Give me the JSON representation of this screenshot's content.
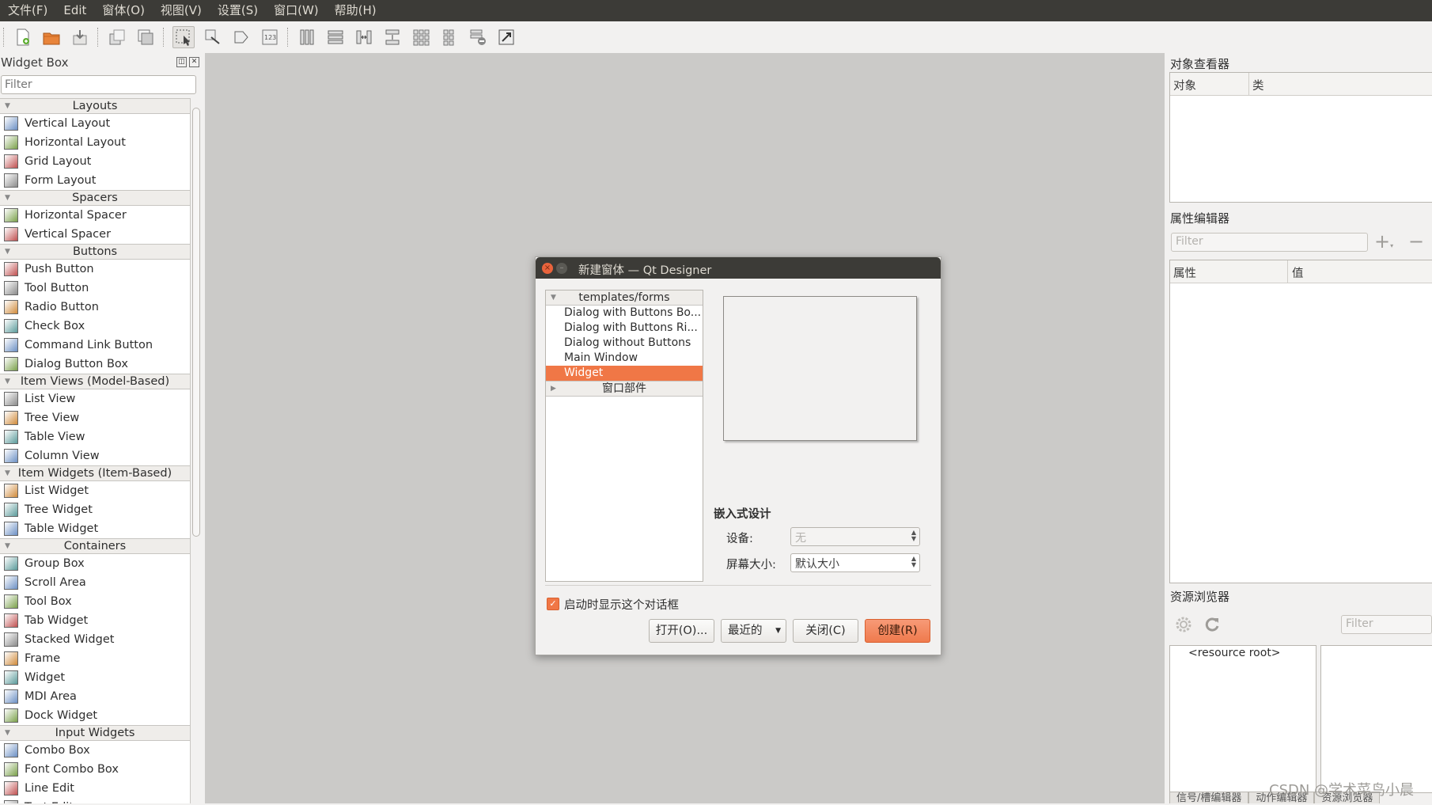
{
  "menu": [
    "文件(F)",
    "Edit",
    "窗体(O)",
    "视图(V)",
    "设置(S)",
    "窗口(W)",
    "帮助(H)"
  ],
  "toolbar": {
    "icons": [
      "new-form-icon",
      "open-form-icon",
      "save-form-icon",
      "cut-icon",
      "copy-icon",
      "edit-widgets-icon",
      "edit-signals-icon",
      "edit-buddies-icon",
      "edit-tab-order-icon",
      "lay-out-horizontally-icon",
      "lay-out-vertically-icon",
      "horizontal-splitter-icon",
      "vertical-splitter-icon",
      "grid-layout-icon",
      "form-layout-icon",
      "break-layout-icon",
      "adjust-size-icon"
    ]
  },
  "widget_box": {
    "title": "Widget Box",
    "filter_placeholder": "Filter",
    "categories": [
      {
        "name": "Layouts",
        "items": [
          "Vertical Layout",
          "Horizontal Layout",
          "Grid Layout",
          "Form Layout"
        ]
      },
      {
        "name": "Spacers",
        "items": [
          "Horizontal Spacer",
          "Vertical Spacer"
        ]
      },
      {
        "name": "Buttons",
        "items": [
          "Push Button",
          "Tool Button",
          "Radio Button",
          "Check Box",
          "Command Link Button",
          "Dialog Button Box"
        ]
      },
      {
        "name": "Item Views (Model-Based)",
        "items": [
          "List View",
          "Tree View",
          "Table View",
          "Column View"
        ]
      },
      {
        "name": "Item Widgets (Item-Based)",
        "items": [
          "List Widget",
          "Tree Widget",
          "Table Widget"
        ]
      },
      {
        "name": "Containers",
        "items": [
          "Group Box",
          "Scroll Area",
          "Tool Box",
          "Tab Widget",
          "Stacked Widget",
          "Frame",
          "Widget",
          "MDI Area",
          "Dock Widget"
        ]
      },
      {
        "name": "Input Widgets",
        "items": [
          "Combo Box",
          "Font Combo Box",
          "Line Edit",
          "Text Edit"
        ]
      }
    ]
  },
  "dialog": {
    "title": "新建窗体 — Qt Designer",
    "tree_header": "templates/forms",
    "templates": [
      "Dialog with Buttons Bo...",
      "Dialog with Buttons Ri...",
      "Dialog without Buttons",
      "Main Window",
      "Widget"
    ],
    "selected_index": 4,
    "second_header": "窗口部件",
    "embedded_title": "嵌入式设计",
    "device_label": "设备:",
    "device_value": "无",
    "screen_label": "屏幕大小:",
    "screen_value": "默认大小",
    "show_on_start_label": "启动时显示这个对话框",
    "show_on_start_checked": true,
    "open_button": "打开(O)...",
    "recent_button": "最近的",
    "close_button": "关闭(C)",
    "create_button": "创建(R)"
  },
  "object_inspector": {
    "title": "对象查看器",
    "col1": "对象",
    "col2": "类"
  },
  "property_editor": {
    "title": "属性编辑器",
    "filter_placeholder": "Filter",
    "col1": "属性",
    "col2": "值"
  },
  "resource_browser": {
    "title": "资源浏览器",
    "filter_placeholder": "Filter",
    "root": "<resource root>"
  },
  "bottom_tabs": [
    "信号/槽编辑器",
    "动作编辑器",
    "资源浏览器"
  ],
  "watermark": "CSDN @学术菜鸟小晨",
  "colors": {
    "accent": "#f07746",
    "menubar": "#3c3b37",
    "canvas": "#cbcac8"
  }
}
